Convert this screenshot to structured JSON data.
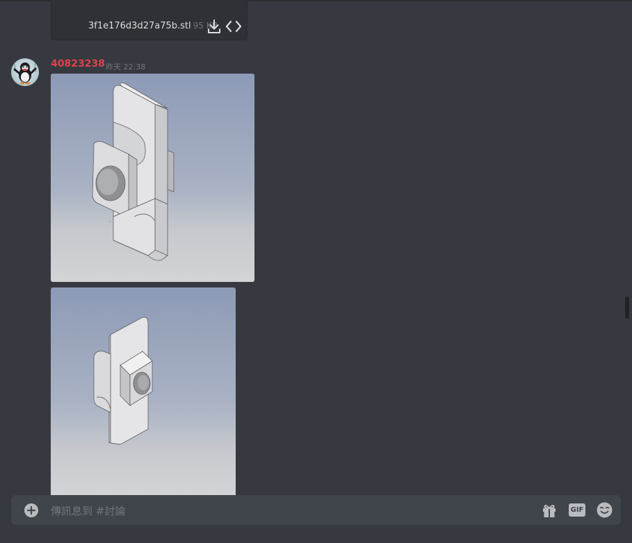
{
  "attachment": {
    "file_name": "3f1e176d3d27a75b.stl",
    "file_size": "95 KB"
  },
  "message": {
    "username": "40823238",
    "timestamp": "昨天 22:38"
  },
  "composer": {
    "placeholder": "傳訊息到 #討論",
    "gif_label": "GIF"
  },
  "colors": {
    "background": "#36393f",
    "composer": "#40444b",
    "username": "#e0424b",
    "muted": "#72767d"
  },
  "icons": [
    "download-icon",
    "code-icon",
    "add-circle-icon",
    "gift-icon",
    "emoji-icon",
    "penguin-avatar"
  ]
}
